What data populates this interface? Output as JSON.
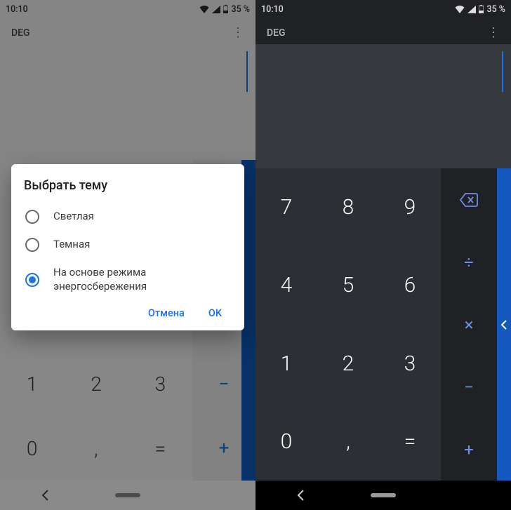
{
  "left": {
    "status": {
      "time": "10:10",
      "battery": "35 %"
    },
    "header": {
      "mode": "DEG"
    },
    "dialog": {
      "title": "Выбрать тему",
      "options": {
        "opt1": "Светлая",
        "opt2": "Темная",
        "opt3": "На основе режима энергосбережения"
      },
      "selected_index": 2,
      "cancel": "Отмена",
      "ok": "OK"
    },
    "numpad": {
      "r3c0": "1",
      "r3c1": "2",
      "r3c2": "3",
      "r4c0": "0",
      "r4c1": ",",
      "r4c2": "="
    },
    "ops": {
      "minus": "−",
      "plus": "+"
    }
  },
  "right": {
    "status": {
      "time": "10:10",
      "battery": "35 %"
    },
    "header": {
      "mode": "DEG"
    },
    "numpad": {
      "r0c0": "7",
      "r0c1": "8",
      "r0c2": "9",
      "r1c0": "4",
      "r1c1": "5",
      "r1c2": "6",
      "r2c0": "1",
      "r2c1": "2",
      "r2c2": "3",
      "r3c0": "0",
      "r3c1": ",",
      "r3c2": "="
    },
    "ops": {
      "divide": "÷",
      "multiply": "×",
      "minus": "−",
      "plus": "+"
    }
  }
}
